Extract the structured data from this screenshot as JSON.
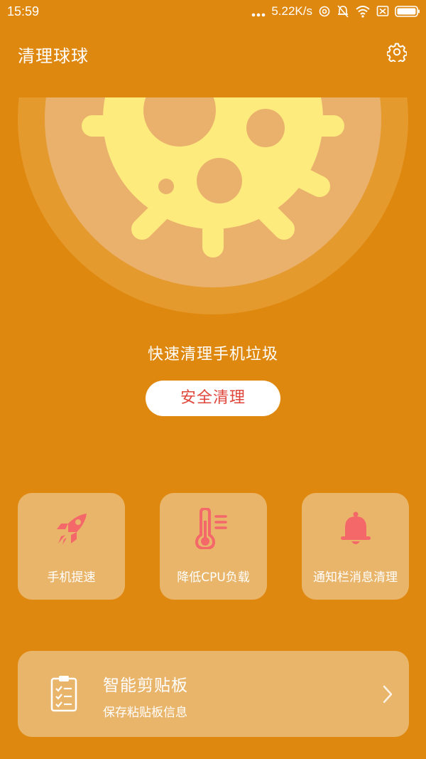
{
  "status_bar": {
    "time": "15:59",
    "network_speed": "5.22K/s",
    "icons": [
      "more-dots-icon",
      "hotspot-icon",
      "mute-bell-icon",
      "wifi-icon",
      "no-sim-icon",
      "battery-icon"
    ]
  },
  "app_bar": {
    "title": "清理球球",
    "settings_icon": "gear-icon"
  },
  "hero": {
    "tagline": "快速清理手机垃圾",
    "button_label": "安全清理"
  },
  "features": [
    {
      "label": "手机提速",
      "icon": "rocket-icon"
    },
    {
      "label": "降低CPU负载",
      "icon": "thermometer-icon"
    },
    {
      "label": "通知栏消息清理",
      "icon": "bell-icon"
    }
  ],
  "clipboard": {
    "title": "智能剪贴板",
    "subtitle": "保存粘贴板信息",
    "icon": "clipboard-icon",
    "arrow_icon": "chevron-right-icon"
  },
  "colors": {
    "background": "#df880f",
    "card": "#e9b56a",
    "accent_red": "#e0463b",
    "icon_pink": "#f4686a",
    "virus_yellow": "#fdeb7e"
  }
}
